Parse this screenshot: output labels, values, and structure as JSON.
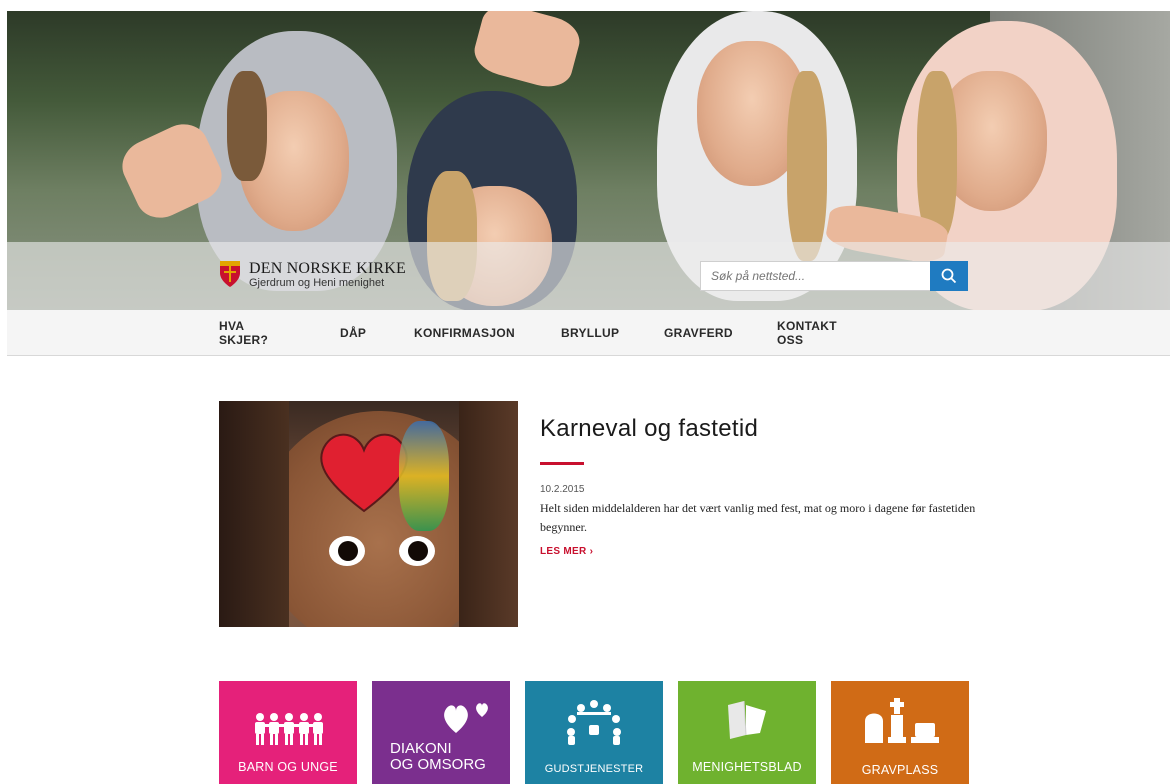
{
  "brand": {
    "org_name": "DEN NORSKE KIRKE",
    "parish": "Gjerdrum og Heni menighet"
  },
  "search": {
    "placeholder": "Søk på nettsted..."
  },
  "nav": {
    "items": [
      {
        "label": "HVA SKJER?"
      },
      {
        "label": "DÅP"
      },
      {
        "label": "KONFIRMASJON"
      },
      {
        "label": "BRYLLUP"
      },
      {
        "label": "GRAVFERD"
      },
      {
        "label": "KONTAKT OSS"
      }
    ]
  },
  "article": {
    "title": "Karneval og fastetid",
    "date": "10.2.2015",
    "excerpt": "Helt siden middelalderen har det vært vanlig med fest, mat og moro i dagene før fastetiden begynner.",
    "read_more": "LES MER  ›"
  },
  "tiles": [
    {
      "label": "BARN OG UNGE",
      "color": "#e5217a",
      "icon": "children-icon"
    },
    {
      "label_line1": "DIAKONI",
      "label_line2": "OG OMSORG",
      "color": "#7b2f8e",
      "icon": "hearts-icon"
    },
    {
      "label": "GUDSTJENESTER",
      "color": "#1d82a3",
      "icon": "congregation-circle-icon"
    },
    {
      "label": "MENIGHETSBLAD",
      "color": "#6fb22f",
      "icon": "open-book-icon"
    },
    {
      "label": "GRAVPLASS",
      "color": "#d06b16",
      "icon": "gravestones-icon"
    }
  ],
  "colors": {
    "accent_red": "#c8102e",
    "search_blue": "#1f7bc1"
  }
}
